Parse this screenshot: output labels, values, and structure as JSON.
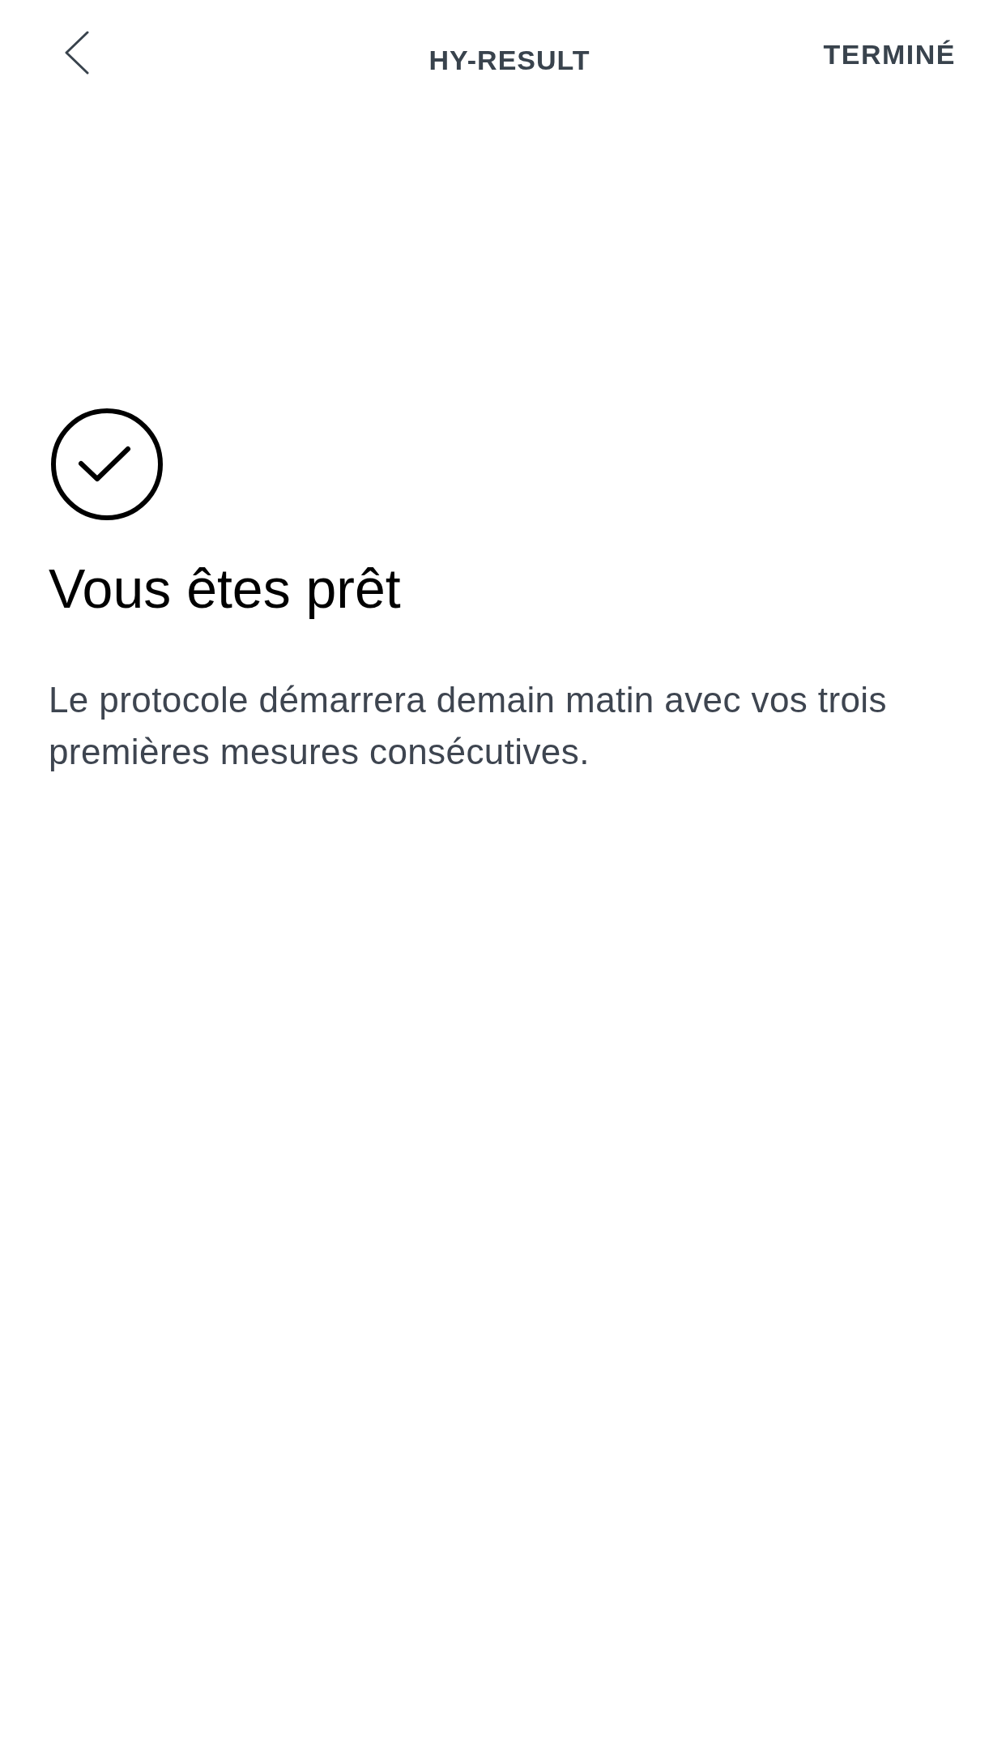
{
  "header": {
    "title": "HY-RESULT",
    "done_button": "TERMINÉ"
  },
  "content": {
    "heading": "Vous êtes prêt",
    "body": "Le protocole démarrera demain matin avec vos trois premières mesures consécutives."
  }
}
